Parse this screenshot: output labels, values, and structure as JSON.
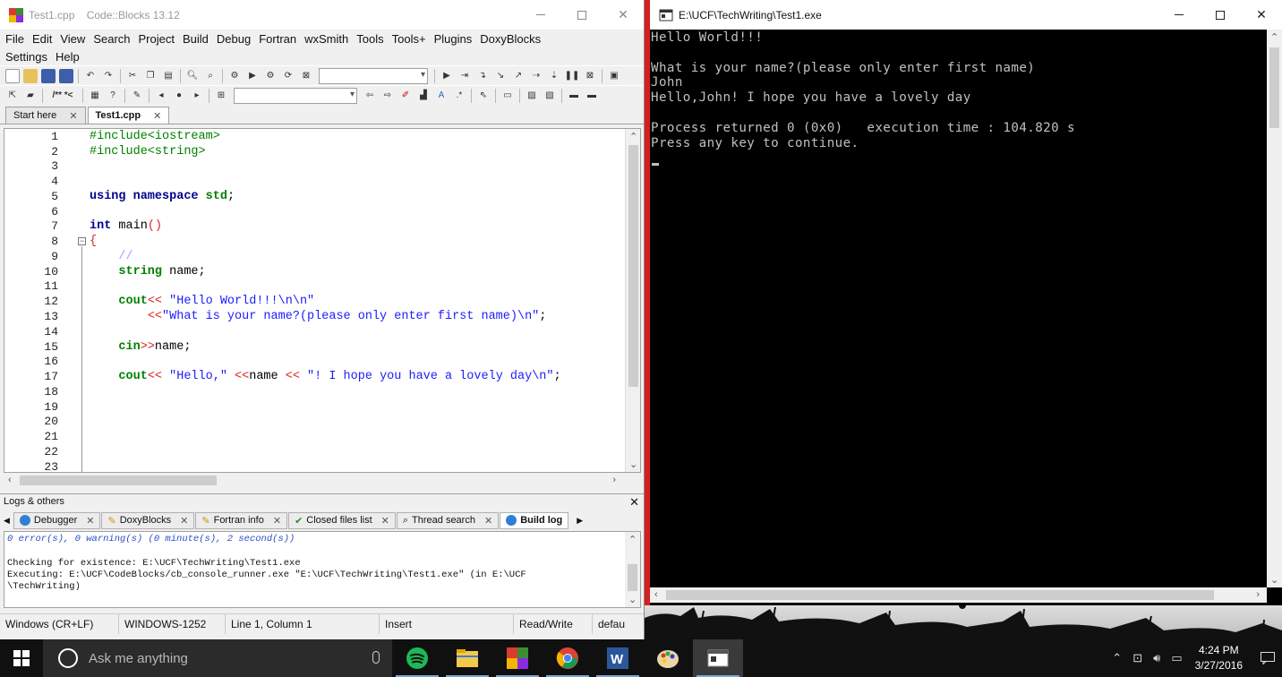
{
  "codeblocks": {
    "title": "Test1.cpp    Code::Blocks 13.12",
    "menu_row1": [
      "File",
      "Edit",
      "View",
      "Search",
      "Project",
      "Build",
      "Debug",
      "Fortran",
      "wxSmith",
      "Tools",
      "Tools+",
      "Plugins",
      "DoxyBlocks"
    ],
    "menu_row2": [
      "Settings",
      "Help"
    ],
    "file_tabs": [
      {
        "label": "Start here",
        "active": false
      },
      {
        "label": "Test1.cpp",
        "active": true
      }
    ],
    "line_numbers": [
      "1",
      "2",
      "3",
      "4",
      "5",
      "6",
      "7",
      "8",
      "9",
      "10",
      "11",
      "12",
      "13",
      "14",
      "15",
      "16",
      "17",
      "18",
      "19",
      "20",
      "21",
      "22",
      "23"
    ],
    "code": {
      "l1": "#include<iostream>",
      "l2": "#include<string>",
      "l5_kw": "using namespace",
      "l5_id": "std",
      "l5_end": ";",
      "l7_ty": "int",
      "l7_id": " main",
      "l7_par": "()",
      "l8": "{",
      "l9": "//",
      "l10_ty": "string",
      "l10_rest": " name;",
      "l12_id": "cout",
      "l12_op": "<<",
      "l12_str": " \"Hello World!!!\\n\\n\"",
      "l13_op": "<<",
      "l13_str": "\"What is your name?(please only enter first name)\\n\"",
      "l13_end": ";",
      "l15_id": "cin",
      "l15_op": ">>",
      "l15_rest": "name;",
      "l17_id": "cout",
      "l17_op1": "<<",
      "l17_str1": " \"Hello,\" ",
      "l17_op2": "<<",
      "l17_mid": "name ",
      "l17_op3": "<<",
      "l17_str2": " \"! I hope you have a lovely day\\n\"",
      "l17_end": ";"
    },
    "logs_title": "Logs & others",
    "log_tabs": [
      "Debugger",
      "DoxyBlocks",
      "Fortran info",
      "Closed files list",
      "Thread search",
      "Build log"
    ],
    "log_lines": [
      "0 error(s), 0 warning(s) (0 minute(s), 2 second(s))",
      "",
      "Checking for existence: E:\\UCF\\TechWriting\\Test1.exe",
      "Executing: E:\\UCF\\CodeBlocks/cb_console_runner.exe \"E:\\UCF\\TechWriting\\Test1.exe\" (in E:\\UCF",
      "\\TechWriting)"
    ],
    "status": [
      "Windows (CR+LF)",
      "WINDOWS-1252",
      "Line 1, Column 1",
      "Insert",
      "",
      "Read/Write",
      "defau"
    ]
  },
  "console": {
    "title": "E:\\UCF\\TechWriting\\Test1.exe",
    "lines": [
      "Hello World!!!",
      "",
      "What is your name?(please only enter first name)",
      "John",
      "Hello,John! I hope you have a lovely day",
      "",
      "Process returned 0 (0x0)   execution time : 104.820 s",
      "Press any key to continue."
    ]
  },
  "taskbar": {
    "search_placeholder": "Ask me anything",
    "time": "4:24 PM",
    "date": "3/27/2016",
    "apps": [
      "spotify-icon",
      "file-explorer-icon",
      "codeblocks-icon",
      "chrome-icon",
      "word-icon",
      "paint-icon",
      "console-icon"
    ]
  }
}
